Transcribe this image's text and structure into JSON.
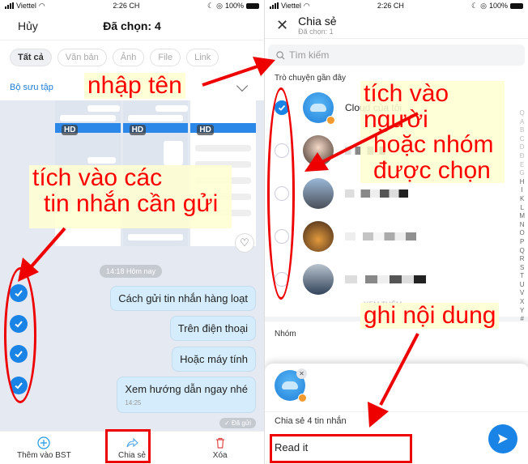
{
  "status_bar": {
    "carrier": "Viettel",
    "time": "2:26 CH",
    "battery": "100%"
  },
  "left_panel": {
    "header": {
      "cancel_label": "Hủy",
      "title": "Đã chọn: 4"
    },
    "filters": [
      {
        "label": "Tất cả",
        "active": true
      },
      {
        "label": "Văn bản",
        "active": false
      },
      {
        "label": "Ảnh",
        "active": false
      },
      {
        "label": "File",
        "active": false
      },
      {
        "label": "Link",
        "active": false
      }
    ],
    "collection_label": "Bộ sưu tập",
    "thumbnail_badge": "HD",
    "time_separator": "14:18 Hôm nay",
    "messages": [
      {
        "text": "Cách gửi tin nhắn hàng loạt",
        "selected": true
      },
      {
        "text": "Trên điện thoại",
        "selected": true
      },
      {
        "text": "Hoặc máy tính",
        "selected": true
      },
      {
        "text": "Xem hướng dẫn ngay nhé",
        "time": "14:25",
        "selected": true
      }
    ],
    "sent_status": "✓ Đã gửi",
    "bottom_bar": [
      {
        "label": "Thêm vào BST",
        "icon": "plus-circle-icon"
      },
      {
        "label": "Chia sẻ",
        "icon": "share-icon"
      },
      {
        "label": "Xóa",
        "icon": "trash-icon"
      }
    ]
  },
  "right_panel": {
    "header": {
      "title": "Chia sẻ",
      "subtitle": "Đã chọn: 1"
    },
    "search_placeholder": "Tìm kiếm",
    "recent_label": "Trò chuyện gần đây",
    "contacts": [
      {
        "name": "Cloud của tôi",
        "checked": true
      },
      {
        "name": "",
        "checked": false
      },
      {
        "name": "",
        "checked": false
      },
      {
        "name": "",
        "checked": false
      },
      {
        "name": "",
        "checked": false
      }
    ],
    "see_more": "XEM THÊM",
    "alphabet": [
      "Q",
      "A",
      "B",
      "C",
      "D",
      "Đ",
      "E",
      "G",
      "H",
      "I",
      "K",
      "L",
      "M",
      "N",
      "O",
      "P",
      "Q",
      "R",
      "S",
      "T",
      "U",
      "V",
      "X",
      "Y",
      "#"
    ],
    "groups_label": "Nhóm",
    "sheet": {
      "share_count_text": "Chia sẻ 4 tin nhắn",
      "message_value": "Read it"
    }
  },
  "annotations": {
    "enter_name": "nhập tên",
    "tick_messages_1": "tích vào các",
    "tick_messages_2": "tin nhắn cần gửi",
    "tick_contacts_1": "tích vào người",
    "tick_contacts_2": "hoặc nhóm",
    "tick_contacts_3": "được chọn",
    "write_content": "ghi nội dung"
  },
  "colors": {
    "accent": "#1a83e6",
    "annotation": "#ff0000",
    "bubble": "#d4ecfb"
  }
}
